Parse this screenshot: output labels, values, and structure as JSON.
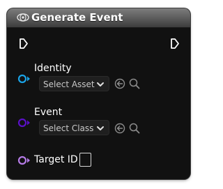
{
  "node": {
    "title": "Generate Event",
    "header_icon": "function-node-icon",
    "exec_in_icon": "exec-pin-icon",
    "exec_out_icon": "exec-pin-icon",
    "pins": [
      {
        "label": "Identity",
        "pin_color": "#1aa3e6",
        "dropdown_value": "Select Asset",
        "actions": [
          "browse-arrow-icon",
          "search-icon"
        ]
      },
      {
        "label": "Event",
        "pin_color": "#5a10c8",
        "dropdown_value": "Select Class",
        "actions": [
          "browse-arrow-icon",
          "search-icon"
        ]
      },
      {
        "label": "Target ID",
        "pin_color": "#b57be6",
        "checked": false
      }
    ]
  }
}
